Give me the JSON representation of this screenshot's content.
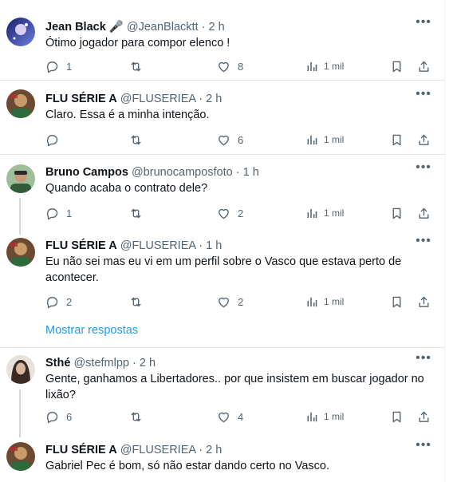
{
  "tweets": [
    {
      "name": "Jean Black 🎤",
      "handle": "@JeanBlacktt",
      "time": "2 h",
      "text": "Ótimo jogador para compor elenco !",
      "replies": "1",
      "retweets": "",
      "likes": "8",
      "views": "1 mil",
      "avatar_colors": [
        "#1a1f6b",
        "#6f7fe0"
      ]
    },
    {
      "name": "FLU SÉRIE A",
      "handle": "@FLUSERIEA",
      "time": "2 h",
      "text": "Claro. Essa é a minha intenção.",
      "replies": "",
      "retweets": "",
      "likes": "6",
      "views": "1 mil",
      "avatar_colors": [
        "#5b3a2a",
        "#c89b6b"
      ]
    },
    {
      "name": "Bruno Campos",
      "handle": "@brunocamposfoto",
      "time": "1 h",
      "text": "Quando acaba o contrato dele?",
      "replies": "1",
      "retweets": "",
      "likes": "2",
      "views": "1 mil",
      "avatar_colors": [
        "#2f5d3a",
        "#8fb38a"
      ]
    },
    {
      "name": "FLU SÉRIE A",
      "handle": "@FLUSERIEA",
      "time": "1 h",
      "text": "Eu não sei mas eu vi em um perfil sobre o Vasco que estava perto de acontecer.",
      "replies": "2",
      "retweets": "",
      "likes": "2",
      "views": "1 mil",
      "avatar_colors": [
        "#5b3a2a",
        "#c89b6b"
      ]
    },
    {
      "name": "Sthé",
      "handle": "@stefmlpp",
      "time": "2 h",
      "text": "Gente, ganhamos a Libertadores.. por que insistem em buscar jogador no lixão?",
      "replies": "6",
      "retweets": "",
      "likes": "4",
      "views": "1 mil",
      "avatar_colors": [
        "#3a2a22",
        "#d8b9a0"
      ]
    },
    {
      "name": "FLU SÉRIE A",
      "handle": "@FLUSERIEA",
      "time": "2 h",
      "text": "Gabriel Pec é bom, só não estar dando certo no Vasco.",
      "replies": "",
      "retweets": "",
      "likes": "",
      "views": "",
      "avatar_colors": [
        "#5b3a2a",
        "#c89b6b"
      ]
    }
  ],
  "show_more": "Mostrar respostas",
  "separator": "·",
  "icons": {
    "more": "more-icon",
    "reply": "reply-icon",
    "retweet": "retweet-icon",
    "like": "heart-icon",
    "views": "views-icon",
    "bookmark": "bookmark-icon",
    "share": "share-icon"
  },
  "colors": {
    "text": "#0f1419",
    "secondary": "#536471",
    "link": "#1d9bf0",
    "border": "#e1e6ea",
    "thread": "#cfd9de"
  }
}
